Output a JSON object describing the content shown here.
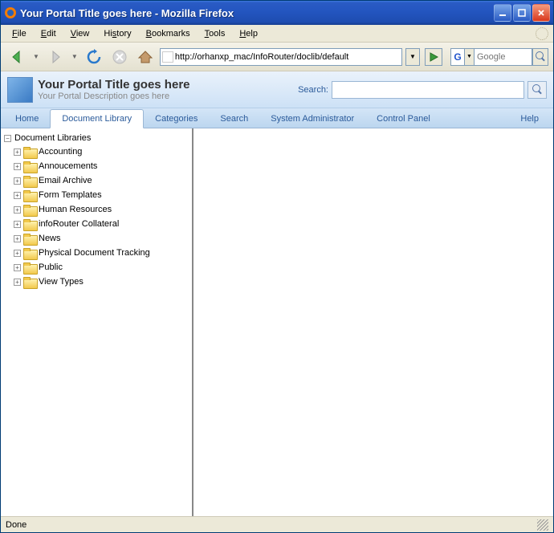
{
  "window": {
    "title": "Your Portal Title goes here - Mozilla Firefox"
  },
  "menubar": [
    "File",
    "Edit",
    "View",
    "History",
    "Bookmarks",
    "Tools",
    "Help"
  ],
  "url": "http://orhanxp_mac/InfoRouter/doclib/default",
  "browser_search_placeholder": "Google",
  "portal": {
    "title": "Your Portal Title goes here",
    "description": "Your Portal Description goes here",
    "search_label": "Search:"
  },
  "tabs": {
    "home": "Home",
    "doclib": "Document Library",
    "categories": "Categories",
    "search": "Search",
    "sysadmin": "System Administrator",
    "controlpanel": "Control Panel",
    "help": "Help"
  },
  "tree": {
    "root": "Document Libraries",
    "items": [
      "Accounting",
      "Annoucements",
      "Email Archive",
      "Form Templates",
      "Human Resources",
      "infoRouter Collateral",
      "News",
      "Physical Document Tracking",
      "Public",
      "View Types"
    ]
  },
  "status": "Done"
}
